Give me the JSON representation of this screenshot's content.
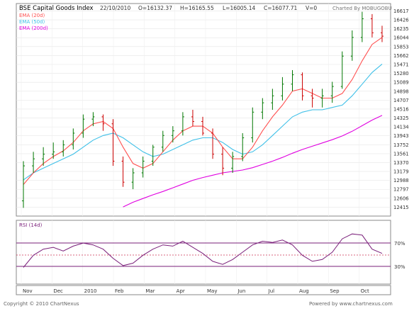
{
  "header": {
    "title": "BSE Capital Goods Index",
    "date": "22/10/2010",
    "open": "O=16132.37",
    "high": "H=16165.55",
    "low": "L=16005.14",
    "close": "C=16077.71",
    "volume": "V=0",
    "charted_by": "Charted By MOBUGOBU"
  },
  "footer": {
    "copyright": "Copyright © 2010 ChartNexus",
    "powered_by": "Powered by www.chartnexus.com"
  },
  "colors": {
    "ema20": "#ff5050",
    "ema50": "#3fc0e8",
    "ema200": "#e000e0",
    "rsi": "#7a1f7a",
    "candle": "#007700",
    "candle_down": "#cc0000"
  },
  "chart_data": [
    {
      "type": "line",
      "title": "",
      "legend": [
        "EMA (20d)",
        "EMA (50d)",
        "EMA (200d)"
      ],
      "legend_position": "top-left",
      "grid": true,
      "ylim": [
        12300,
        16700
      ],
      "yticks": [
        "16617",
        "16426",
        "16235",
        "16044",
        "15853",
        "15662",
        "15471",
        "15280",
        "15089",
        "14898",
        "14707",
        "14516",
        "14325",
        "14134",
        "13943",
        "13752",
        "13561",
        "13370",
        "13179",
        "12988",
        "12797",
        "12606",
        "12415"
      ],
      "xticks": [
        "Nov",
        "Dec",
        "2010",
        "Feb",
        "Mar",
        "Apr",
        "May",
        "Jun",
        "Jul",
        "Aug",
        "Sep",
        "Oct"
      ],
      "price_ohlc_weekly": [
        {
          "label": "Nov",
          "open": 12550,
          "high": 13400,
          "low": 12400,
          "close": 13300
        },
        {
          "label": "Nov",
          "open": 13300,
          "high": 13600,
          "low": 13150,
          "close": 13450
        },
        {
          "label": "Nov",
          "open": 13450,
          "high": 13700,
          "low": 13300,
          "close": 13550
        },
        {
          "label": "Dec",
          "open": 13550,
          "high": 13800,
          "low": 13450,
          "close": 13600
        },
        {
          "label": "Dec",
          "open": 13600,
          "high": 13850,
          "low": 13500,
          "close": 13750
        },
        {
          "label": "Dec",
          "open": 13750,
          "high": 14100,
          "low": 13650,
          "close": 14000
        },
        {
          "label": "Dec",
          "open": 14000,
          "high": 14400,
          "low": 13900,
          "close": 14300
        },
        {
          "label": "2010",
          "open": 14300,
          "high": 14450,
          "low": 14150,
          "close": 14350
        },
        {
          "label": "2010",
          "open": 14350,
          "high": 14400,
          "low": 14050,
          "close": 14200
        },
        {
          "label": "2010",
          "open": 14200,
          "high": 14300,
          "low": 13300,
          "close": 13400
        },
        {
          "label": "Feb",
          "open": 13400,
          "high": 13500,
          "low": 12850,
          "close": 12950
        },
        {
          "label": "Feb",
          "open": 12950,
          "high": 13250,
          "low": 12800,
          "close": 13150
        },
        {
          "label": "Feb",
          "open": 13150,
          "high": 13500,
          "low": 13050,
          "close": 13400
        },
        {
          "label": "Mar",
          "open": 13400,
          "high": 13750,
          "low": 13300,
          "close": 13700
        },
        {
          "label": "Mar",
          "open": 13700,
          "high": 14050,
          "low": 13600,
          "close": 13950
        },
        {
          "label": "Mar",
          "open": 13950,
          "high": 14150,
          "low": 13800,
          "close": 14050
        },
        {
          "label": "Apr",
          "open": 14050,
          "high": 14450,
          "low": 13950,
          "close": 14350
        },
        {
          "label": "Apr",
          "open": 14350,
          "high": 14500,
          "low": 14150,
          "close": 14250
        },
        {
          "label": "Apr",
          "open": 14250,
          "high": 14350,
          "low": 13950,
          "close": 14000
        },
        {
          "label": "May",
          "open": 14000,
          "high": 14100,
          "low": 13450,
          "close": 13550
        },
        {
          "label": "May",
          "open": 13550,
          "high": 13700,
          "low": 13100,
          "close": 13250
        },
        {
          "label": "May",
          "open": 13250,
          "high": 13600,
          "low": 13150,
          "close": 13500
        },
        {
          "label": "Jun",
          "open": 13500,
          "high": 14000,
          "low": 13400,
          "close": 13900
        },
        {
          "label": "Jun",
          "open": 13900,
          "high": 14550,
          "low": 13800,
          "close": 14450
        },
        {
          "label": "Jun",
          "open": 14450,
          "high": 14750,
          "low": 14300,
          "close": 14650
        },
        {
          "label": "Jul",
          "open": 14650,
          "high": 14950,
          "low": 14500,
          "close": 14800
        },
        {
          "label": "Jul",
          "open": 14800,
          "high": 15200,
          "low": 14700,
          "close": 15050
        },
        {
          "label": "Jul",
          "open": 15050,
          "high": 15350,
          "low": 14900,
          "close": 15250
        },
        {
          "label": "Aug",
          "open": 15250,
          "high": 15300,
          "low": 14700,
          "close": 14800
        },
        {
          "label": "Aug",
          "open": 14800,
          "high": 14950,
          "low": 14550,
          "close": 14750
        },
        {
          "label": "Aug",
          "open": 14750,
          "high": 14950,
          "low": 14550,
          "close": 14800
        },
        {
          "label": "Sep",
          "open": 14800,
          "high": 15100,
          "low": 14650,
          "close": 15000
        },
        {
          "label": "Sep",
          "open": 15000,
          "high": 15750,
          "low": 14950,
          "close": 15650
        },
        {
          "label": "Sep",
          "open": 15650,
          "high": 16200,
          "low": 15550,
          "close": 16050
        },
        {
          "label": "Oct",
          "open": 16050,
          "high": 16600,
          "low": 15950,
          "close": 16450
        },
        {
          "label": "Oct",
          "open": 16450,
          "high": 16550,
          "low": 16050,
          "close": 16150
        },
        {
          "label": "Oct",
          "open": 16150,
          "high": 16300,
          "low": 15950,
          "close": 16077
        }
      ],
      "series": [
        {
          "name": "EMA (20d)",
          "values": [
            12900,
            13150,
            13350,
            13500,
            13620,
            13800,
            14050,
            14200,
            14250,
            14100,
            13700,
            13350,
            13250,
            13350,
            13600,
            13850,
            14050,
            14150,
            14150,
            14000,
            13700,
            13450,
            13450,
            13700,
            14050,
            14350,
            14600,
            14900,
            14950,
            14850,
            14750,
            14750,
            14850,
            15150,
            15550,
            15900,
            16050
          ]
        },
        {
          "name": "EMA (50d)",
          "values": [
            13000,
            13150,
            13250,
            13350,
            13450,
            13550,
            13700,
            13850,
            13950,
            14000,
            13900,
            13750,
            13600,
            13500,
            13550,
            13650,
            13750,
            13850,
            13900,
            13900,
            13800,
            13650,
            13550,
            13600,
            13750,
            13950,
            14150,
            14350,
            14450,
            14500,
            14500,
            14550,
            14600,
            14800,
            15050,
            15300,
            15480
          ]
        },
        {
          "name": "EMA (200d)",
          "values": [
            null,
            null,
            null,
            null,
            null,
            null,
            null,
            null,
            null,
            null,
            12420,
            12520,
            12600,
            12680,
            12750,
            12830,
            12910,
            12990,
            13050,
            13100,
            13150,
            13180,
            13210,
            13260,
            13330,
            13400,
            13480,
            13570,
            13650,
            13720,
            13790,
            13860,
            13940,
            14040,
            14160,
            14280,
            14380
          ]
        }
      ]
    },
    {
      "type": "line",
      "title": "RSI (14d)",
      "legend": [
        "RSI (14d)"
      ],
      "legend_position": "top-left",
      "ylim": [
        0,
        100
      ],
      "yticks": [
        "70%",
        "30%"
      ],
      "reference_lines": [
        70,
        50,
        30
      ],
      "series": [
        {
          "name": "RSI (14d)",
          "values": [
            25,
            45,
            55,
            58,
            52,
            60,
            65,
            62,
            55,
            40,
            28,
            32,
            45,
            55,
            62,
            60,
            68,
            58,
            48,
            35,
            30,
            38,
            50,
            62,
            68,
            66,
            70,
            62,
            45,
            35,
            38,
            50,
            72,
            80,
            78,
            55,
            48
          ]
        }
      ]
    }
  ]
}
